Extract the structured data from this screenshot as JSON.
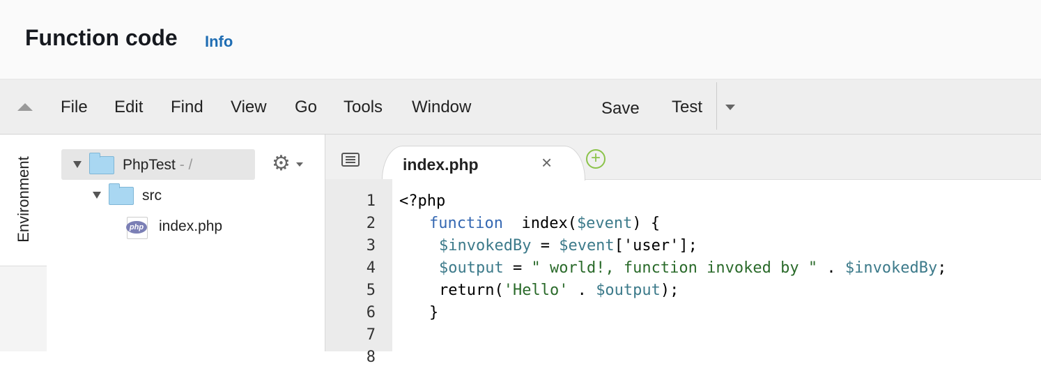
{
  "header": {
    "title": "Function code",
    "info_label": "Info"
  },
  "menubar": {
    "items": [
      "File",
      "Edit",
      "Find",
      "View",
      "Go",
      "Tools",
      "Window"
    ],
    "save_label": "Save",
    "test_label": "Test"
  },
  "sidebar": {
    "environment_label": "Environment"
  },
  "tree": {
    "root_name": "PhpTest",
    "root_suffix": " - /",
    "folder_name": "src",
    "file_name": "index.php"
  },
  "editor": {
    "active_tab": "index.php",
    "close_symbol": "×",
    "line_numbers": [
      "1",
      "2",
      "3",
      "4",
      "5",
      "6",
      "7",
      "8"
    ],
    "code": {
      "l1": "<?php",
      "l2_kw": "function",
      "l2_name": "  index(",
      "l2_var": "$event",
      "l2_end": ") {",
      "l3_var1": "$invokedBy",
      "l3_mid": " = ",
      "l3_var2": "$event",
      "l3_end": "['user'];",
      "l4_var1": "$output",
      "l4_mid": " = ",
      "l4_str": "\" world!, function invoked by \"",
      "l4_dot": " . ",
      "l4_var2": "$invokedBy",
      "l4_end": ";",
      "l5_a": "return(",
      "l5_str": "'Hello'",
      "l5_dot": " . ",
      "l5_var": "$output",
      "l5_end": ");",
      "l6": "}"
    }
  },
  "colors": {
    "link": "#1f6db3",
    "keyword": "#3568b2",
    "variable": "#3c7a8a",
    "string": "#2a6a2a",
    "add_tab": "#8bc34a"
  }
}
